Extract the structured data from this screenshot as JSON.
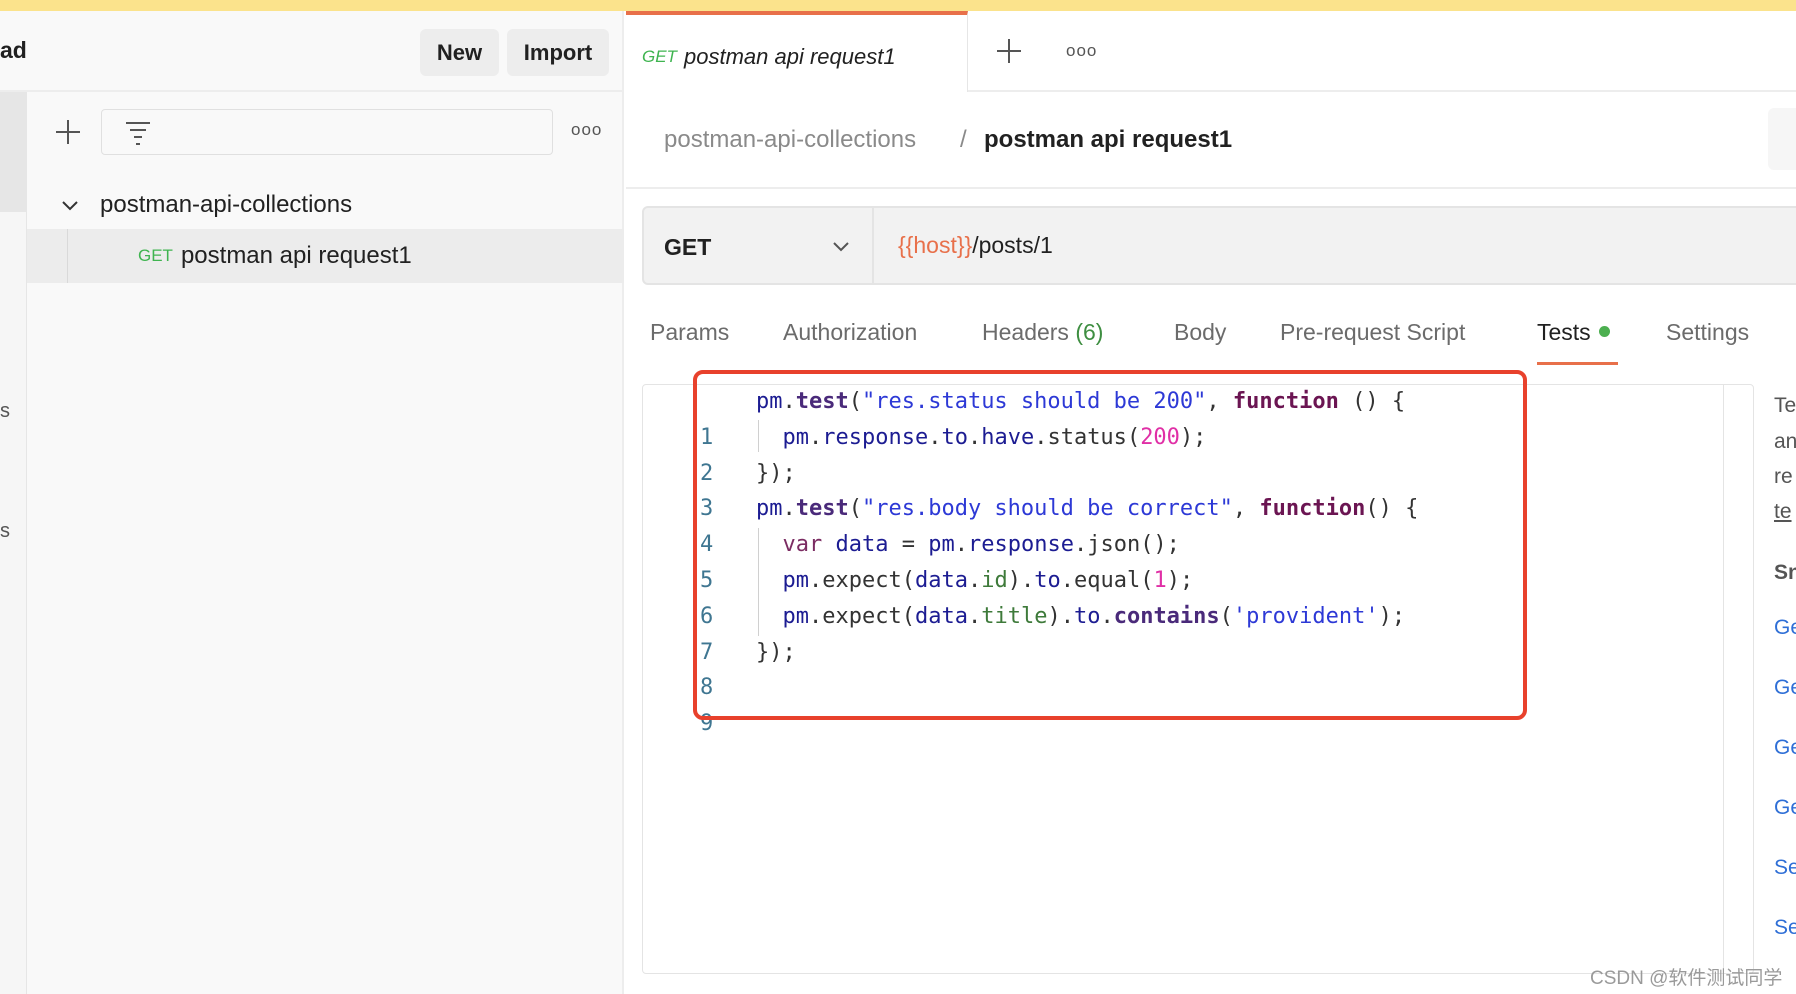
{
  "sidebar": {
    "workspace_title_fragment": "ad",
    "new_label": "New",
    "import_label": "Import",
    "more_icon": "ooo",
    "collection": {
      "name": "postman-api-collections",
      "expanded": true,
      "requests": [
        {
          "method": "GET",
          "name": "postman api request1"
        }
      ]
    },
    "rail_fragments": [
      "s",
      "s"
    ]
  },
  "request_tab": {
    "method": "GET",
    "name": "postman api request1"
  },
  "breadcrumb": {
    "collection": "postman-api-collections",
    "separator": "/",
    "request": "postman api request1"
  },
  "url_bar": {
    "method": "GET",
    "url_variable": "{{host}}",
    "url_path": "/posts/1"
  },
  "tabs": [
    {
      "label": "Params"
    },
    {
      "label": "Authorization"
    },
    {
      "label": "Headers",
      "count": "(6)"
    },
    {
      "label": "Body"
    },
    {
      "label": "Pre-request Script"
    },
    {
      "label": "Tests",
      "active": true
    },
    {
      "label": "Settings"
    }
  ],
  "editor": {
    "line_numbers": [
      "1",
      "2",
      "3",
      "4",
      "5",
      "6",
      "7",
      "8",
      "9"
    ],
    "lines": [
      "pm.test(\"res.status should be 200\", function () {",
      "  pm.response.to.have.status(200);",
      "});",
      "pm.test(\"res.body should be correct\", function() {",
      "  var data = pm.response.json();",
      "  pm.expect(data.id).to.equal(1);",
      "  pm.expect(data.title).to.contains('provident');",
      "});",
      ""
    ]
  },
  "right_panel": {
    "text_fragments": [
      "Te",
      "an",
      "re",
      "te"
    ],
    "heading_fragment": "Sn",
    "snippet_fragments": [
      "Ge",
      "Ge",
      "Ge",
      "Ge",
      "Se",
      "Se"
    ]
  },
  "watermark": "CSDN @软件测试同学",
  "colors": {
    "accent": "#e8704a",
    "highlight_box": "#e8412c",
    "get_method": "#3fb450",
    "tests_dot": "#4caf50",
    "variable": "#e8704a"
  }
}
